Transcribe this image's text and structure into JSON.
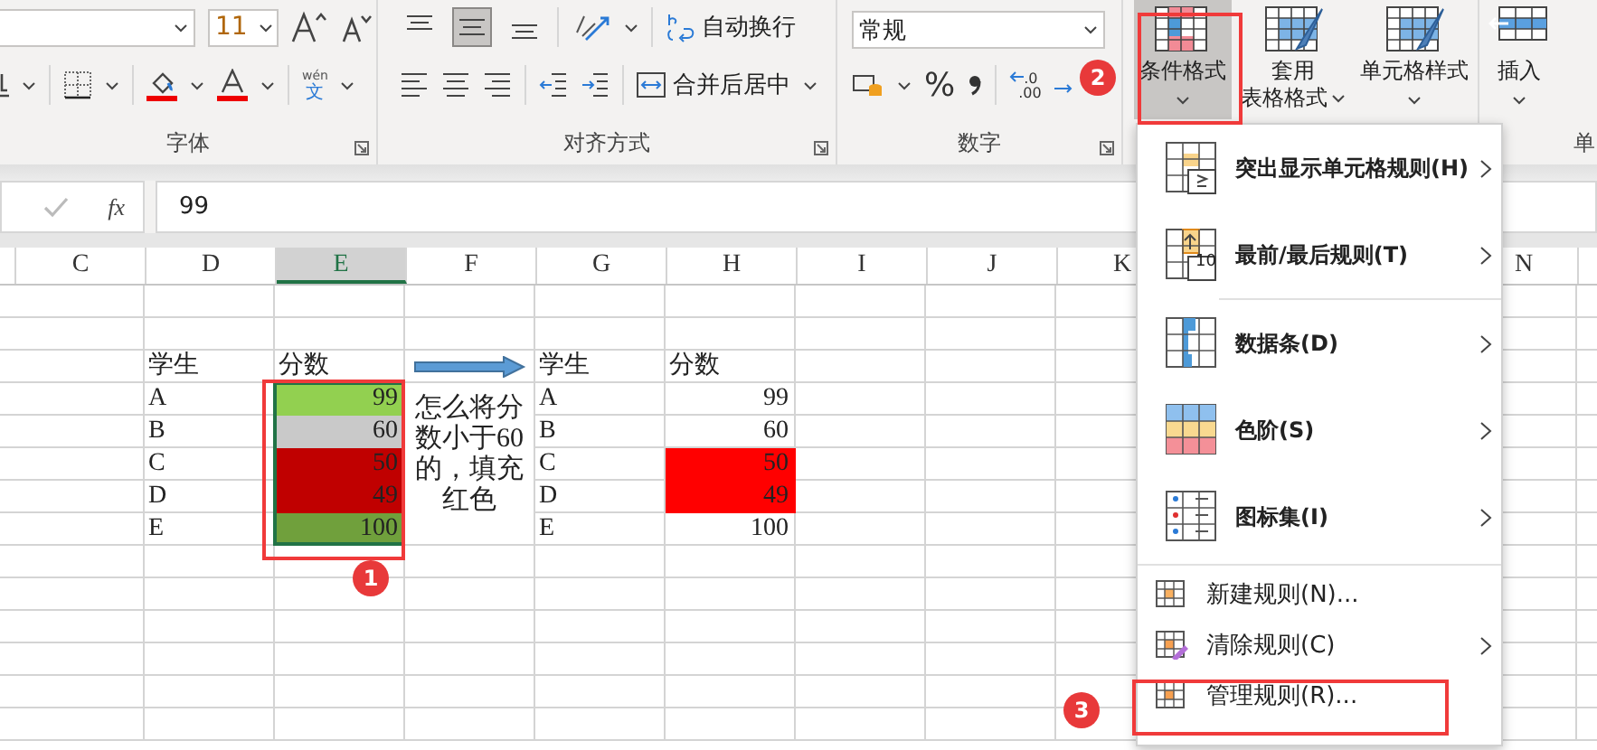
{
  "ribbon": {
    "font_group": {
      "label": "字体",
      "font_size": "11",
      "phonetic_top": "wén",
      "phonetic_bottom": "文"
    },
    "alignment_group": {
      "label": "对齐方式",
      "vertical_align": [
        {
          "selected": false
        },
        {
          "selected": true
        },
        {
          "selected": false
        }
      ],
      "wrap_text": "自动换行",
      "merge_center": "合并后居中"
    },
    "number_group": {
      "label": "数字",
      "format": "常规",
      "percent": "%",
      "increase_decimal_top": ".0",
      "increase_decimal_bottom": ".00"
    },
    "styles_group": {
      "buttons": [
        {
          "lines": [
            "条件格式"
          ],
          "selected": true
        },
        {
          "lines": [
            "套用",
            "表格格式"
          ],
          "selected": false
        },
        {
          "lines": [
            "单元格样式"
          ],
          "selected": false
        }
      ]
    },
    "cells_group": {
      "insert": "插入",
      "label": "单"
    }
  },
  "formula_bar": {
    "fx": "fx",
    "value": "99"
  },
  "columns": [
    {
      "label": "C",
      "selected": false
    },
    {
      "label": "D",
      "selected": false
    },
    {
      "label": "E",
      "selected": true
    },
    {
      "label": "F",
      "selected": false
    },
    {
      "label": "G",
      "selected": false
    },
    {
      "label": "H",
      "selected": false
    },
    {
      "label": "I",
      "selected": false
    },
    {
      "label": "J",
      "selected": false
    },
    {
      "label": "K",
      "selected": false
    }
  ],
  "far_column": "N",
  "table_1": {
    "headers": [
      "学生",
      "分数"
    ],
    "rows": [
      {
        "name": "A",
        "score": "99",
        "color": "#92d050"
      },
      {
        "name": "B",
        "score": "60",
        "color": "#c9c9c9"
      },
      {
        "name": "C",
        "score": "50",
        "color": "#c00000"
      },
      {
        "name": "D",
        "score": "49",
        "color": "#c00000"
      },
      {
        "name": "E",
        "score": "100",
        "color": "#70a03c"
      }
    ]
  },
  "note": "怎么将分数小于60的，填充红色",
  "table_2": {
    "headers": [
      "学生",
      "分数"
    ],
    "rows": [
      {
        "name": "A",
        "score": "99",
        "highlighted": false
      },
      {
        "name": "B",
        "score": "60",
        "highlighted": false
      },
      {
        "name": "C",
        "score": "50",
        "highlighted": true
      },
      {
        "name": "D",
        "score": "49",
        "highlighted": true
      },
      {
        "name": "E",
        "score": "100",
        "highlighted": false
      }
    ]
  },
  "menu": {
    "items": [
      {
        "kind": "large",
        "label": "突出显示单元格规则(H)",
        "has_submenu": true
      },
      {
        "kind": "large",
        "label": "最前/最后规则(T)",
        "has_submenu": true,
        "icon_text": "10"
      },
      {
        "kind": "large",
        "label": "数据条(D)",
        "has_submenu": true
      },
      {
        "kind": "large",
        "label": "色阶(S)",
        "has_submenu": true
      },
      {
        "kind": "large",
        "label": "图标集(I)",
        "has_submenu": true
      },
      {
        "kind": "small",
        "label": "新建规则(N)...",
        "has_submenu": false
      },
      {
        "kind": "small",
        "label": "清除规则(C)",
        "has_submenu": true
      },
      {
        "kind": "small",
        "label": "管理规则(R)...",
        "has_submenu": false
      }
    ]
  },
  "annotations": [
    "1",
    "2",
    "3"
  ]
}
